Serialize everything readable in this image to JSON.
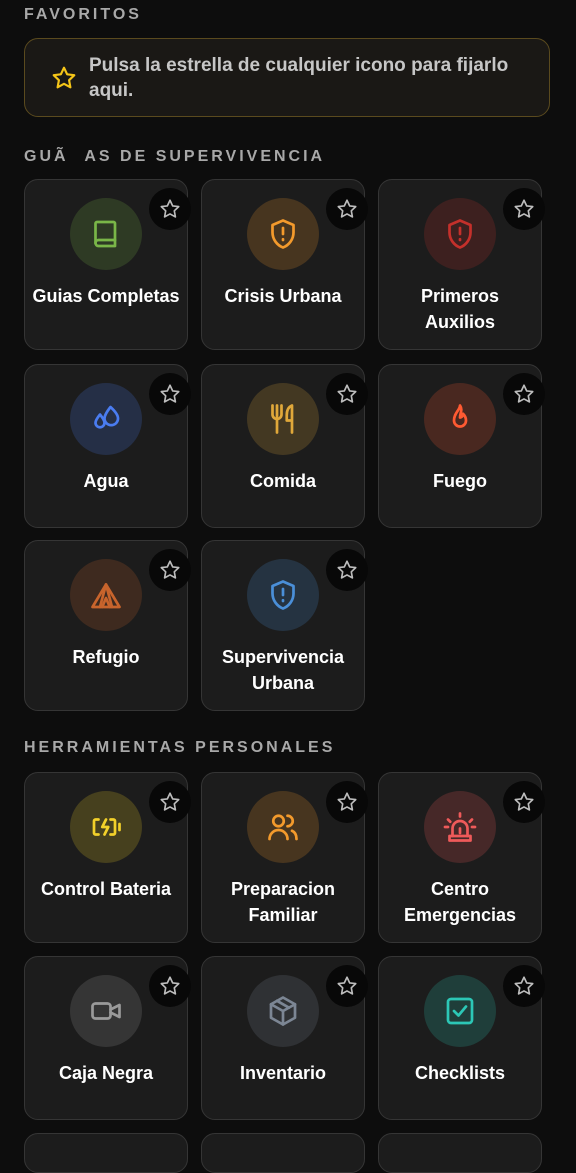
{
  "favorites": {
    "title": "FAVORITOS",
    "hint": "Pulsa la estrella de cualquier icono para fijarlo aqui.",
    "star_color": "#f5c518"
  },
  "guides": {
    "title": "GUÃAS DE SUPERVIVENCIA",
    "items": [
      {
        "label": "Guias Completas",
        "icon": "book-icon",
        "color": "#7ab648"
      },
      {
        "label": "Crisis Urbana",
        "icon": "shield-alert-icon",
        "color": "#f39a2c"
      },
      {
        "label": "Primeros Auxilios",
        "icon": "shield-alert-icon",
        "color": "#c4302b"
      },
      {
        "label": "Agua",
        "icon": "droplets-icon",
        "color": "#4a7cf0"
      },
      {
        "label": "Comida",
        "icon": "utensils-icon",
        "color": "#e0a83a"
      },
      {
        "label": "Fuego",
        "icon": "flame-icon",
        "color": "#ff5a32"
      },
      {
        "label": "Refugio",
        "icon": "tent-icon",
        "color": "#c8642c"
      },
      {
        "label": "Supervivencia Urbana",
        "icon": "shield-alert-icon",
        "color": "#4a8fd8"
      }
    ]
  },
  "tools": {
    "title": "HERRAMIENTAS PERSONALES",
    "items": [
      {
        "label": "Control Bateria",
        "icon": "battery-charging-icon",
        "color": "#f2d02a"
      },
      {
        "label": "Preparacion Familiar",
        "icon": "users-icon",
        "color": "#f39a2c"
      },
      {
        "label": "Centro Emergencias",
        "icon": "siren-icon",
        "color": "#ef5a5a"
      },
      {
        "label": "Caja Negra",
        "icon": "video-icon",
        "color": "#9a9a9a"
      },
      {
        "label": "Inventario",
        "icon": "package-icon",
        "color": "#7c8694"
      },
      {
        "label": "Checklists",
        "icon": "checklist-icon",
        "color": "#2cc7b6"
      }
    ]
  }
}
